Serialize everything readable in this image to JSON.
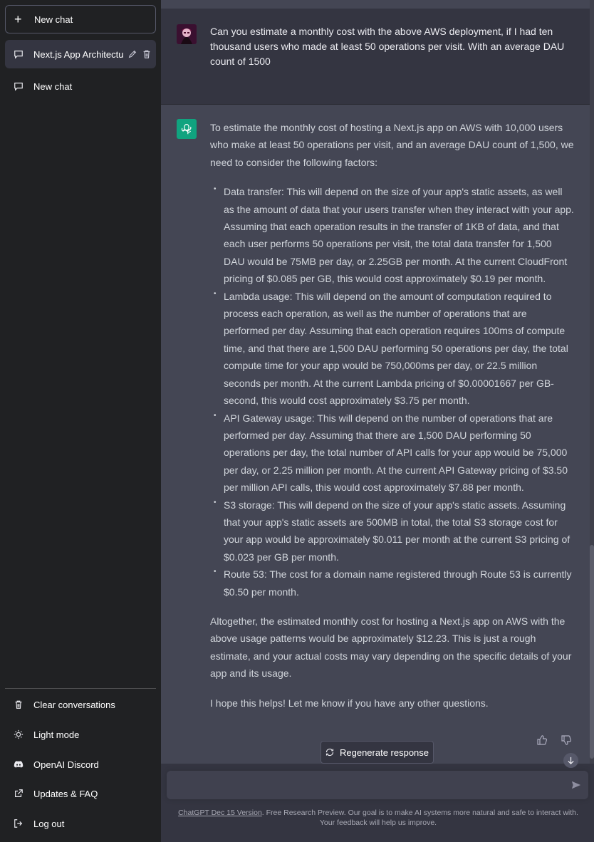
{
  "sidebar": {
    "new_chat_label": "New chat",
    "conversations": [
      {
        "label": "Next.js App Architectu",
        "active": true
      },
      {
        "label": "New chat",
        "active": false
      }
    ],
    "bottom_items": [
      {
        "label": "Clear conversations",
        "icon": "trash-icon"
      },
      {
        "label": "Light mode",
        "icon": "sun-icon"
      },
      {
        "label": "OpenAI Discord",
        "icon": "discord-icon"
      },
      {
        "label": "Updates & FAQ",
        "icon": "external-link-icon"
      },
      {
        "label": "Log out",
        "icon": "logout-icon"
      }
    ]
  },
  "user_message": "Can you estimate a monthly cost with the above AWS deployment, if I had ten thousand users who made at least 50 operations per visit. With an average DAU count of 1500",
  "assistant_message": {
    "intro": "To estimate the monthly cost of hosting a Next.js app on AWS with 10,000 users who make at least 50 operations per visit, and an average DAU count of 1,500, we need to consider the following factors:",
    "bullets": [
      "Data transfer: This will depend on the size of your app's static assets, as well as the amount of data that your users transfer when they interact with your app. Assuming that each operation results in the transfer of 1KB of data, and that each user performs 50 operations per visit, the total data transfer for 1,500 DAU would be 75MB per day, or 2.25GB per month. At the current CloudFront pricing of $0.085 per GB, this would cost approximately $0.19 per month.",
      "Lambda usage: This will depend on the amount of computation required to process each operation, as well as the number of operations that are performed per day. Assuming that each operation requires 100ms of compute time, and that there are 1,500 DAU performing 50 operations per day, the total compute time for your app would be 750,000ms per day, or 22.5 million seconds per month. At the current Lambda pricing of $0.00001667 per GB-second, this would cost approximately $3.75 per month.",
      "API Gateway usage: This will depend on the number of operations that are performed per day. Assuming that there are 1,500 DAU performing 50 operations per day, the total number of API calls for your app would be 75,000 per day, or 2.25 million per month. At the current API Gateway pricing of $3.50 per million API calls, this would cost approximately $7.88 per month.",
      "S3 storage: This will depend on the size of your app's static assets. Assuming that your app's static assets are 500MB in total, the total S3 storage cost for your app would be approximately $0.011 per month at the current S3 pricing of $0.023 per GB per month.",
      "Route 53: The cost for a domain name registered through Route 53 is currently $0.50 per month."
    ],
    "summary": "Altogether, the estimated monthly cost for hosting a Next.js app on AWS with the above usage patterns would be approximately $12.23. This is just a rough estimate, and your actual costs may vary depending on the specific details of your app and its usage.",
    "closing": "I hope this helps! Let me know if you have any other questions."
  },
  "regenerate_label": "Regenerate response",
  "input": {
    "placeholder": ""
  },
  "footer": {
    "link": "ChatGPT Dec 15 Version",
    "text": ". Free Research Preview. Our goal is to make AI systems more natural and safe to interact with. Your feedback will help us improve."
  },
  "colors": {
    "sidebar_bg": "#202123",
    "main_bg": "#343541",
    "assistant_bg": "#444654",
    "gpt_green": "#10a37f"
  }
}
